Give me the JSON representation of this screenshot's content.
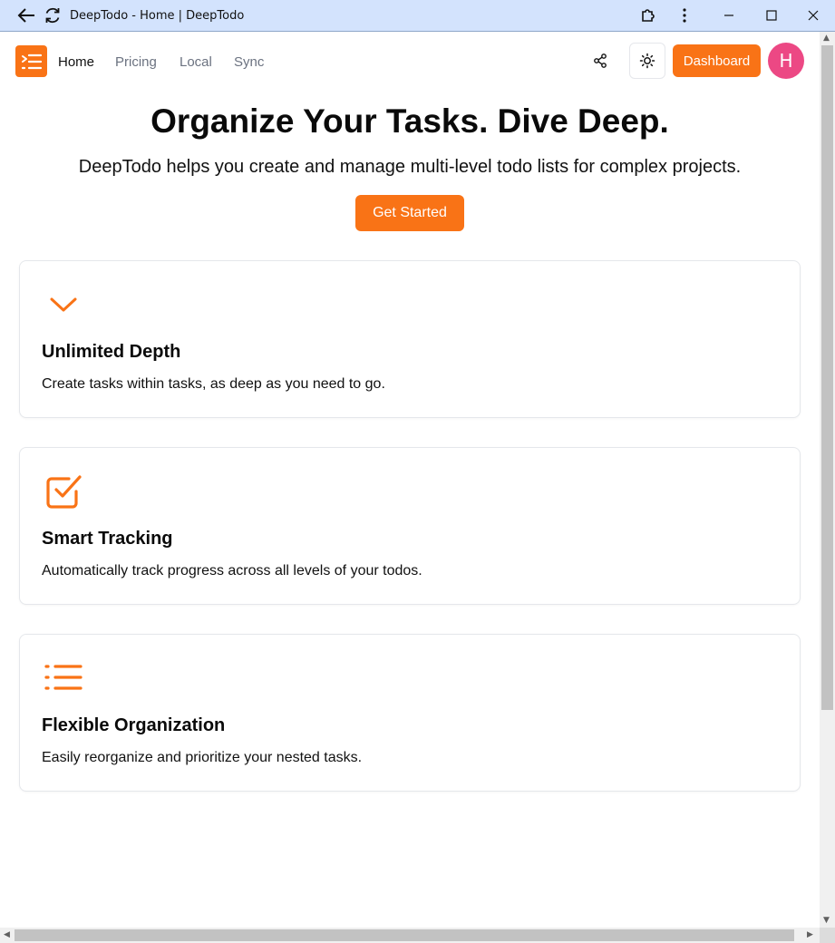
{
  "window": {
    "title": "DeepTodo - Home | DeepTodo"
  },
  "nav": {
    "logo_icon": "list-indent-icon",
    "links": [
      {
        "label": "Home",
        "active": true
      },
      {
        "label": "Pricing",
        "active": false
      },
      {
        "label": "Local",
        "active": false
      },
      {
        "label": "Sync",
        "active": false
      }
    ],
    "dashboard_label": "Dashboard",
    "avatar_initial": "H"
  },
  "hero": {
    "title": "Organize Your Tasks. Dive Deep.",
    "subtitle": "DeepTodo helps you create and manage multi-level todo lists for complex projects.",
    "cta_label": "Get Started"
  },
  "features": [
    {
      "icon": "chevron-down-icon",
      "title": "Unlimited Depth",
      "description": "Create tasks within tasks, as deep as you need to go."
    },
    {
      "icon": "check-square-icon",
      "title": "Smart Tracking",
      "description": "Automatically track progress across all levels of your todos."
    },
    {
      "icon": "list-icon",
      "title": "Flexible Organization",
      "description": "Easily reorganize and prioritize your nested tasks."
    }
  ],
  "colors": {
    "accent": "#f97316",
    "avatar": "#ec4884",
    "titlebar": "#d3e3fd"
  }
}
